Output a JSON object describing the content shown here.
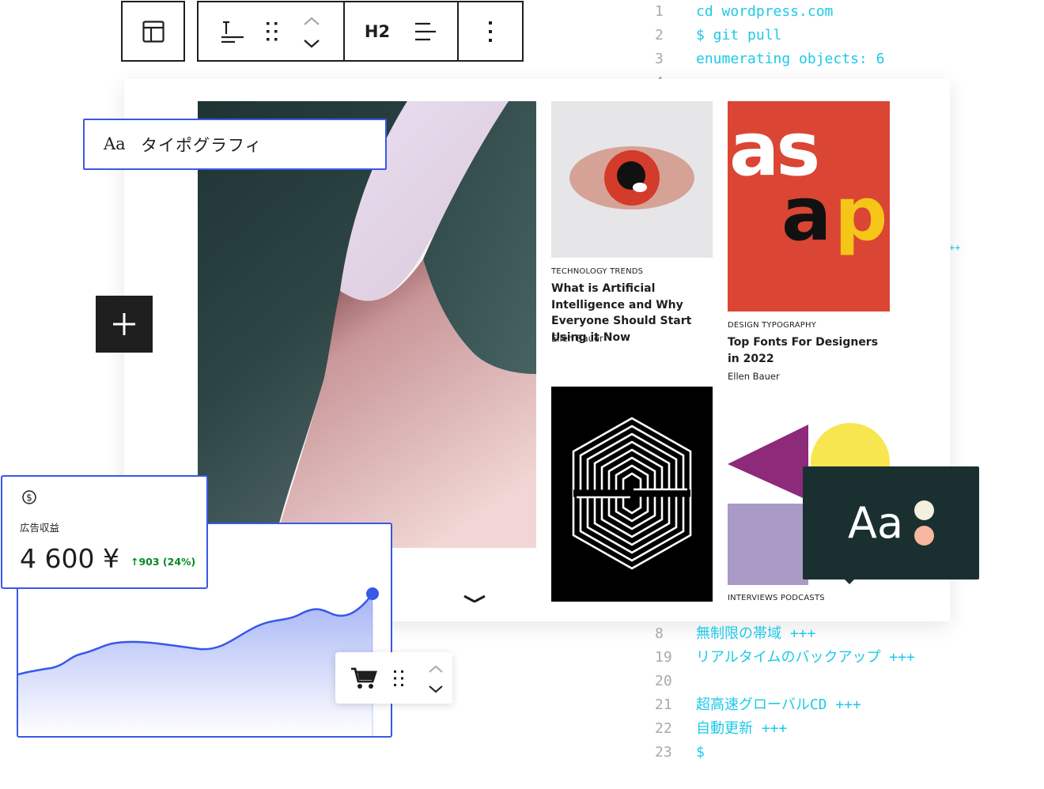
{
  "colors": {
    "accent": "#3858e9",
    "terminal_text": "#1ec9e8",
    "line_number": "#a7aaad",
    "dark": "#1e1e1e",
    "positive": "#008a20"
  },
  "toolbar": {
    "icons": [
      "layout-icon",
      "text-align-icon",
      "drag-handle-icon",
      "move-up-icon",
      "move-down-icon",
      "align-left-icon",
      "more-options-icon"
    ],
    "heading_level_label": "H2"
  },
  "terminal": {
    "top_lines": [
      {
        "num": "1",
        "text": "cd wordpress.com"
      },
      {
        "num": "2",
        "text": "$ git pull"
      },
      {
        "num": "3",
        "text": "enumerating objects: 6"
      },
      {
        "num": "4",
        "text": ""
      }
    ],
    "side_fragment": "++",
    "bottom_lines": [
      {
        "num": "8",
        "text": "無制限の帯域 +++"
      },
      {
        "num": "19",
        "text": "リアルタイムのバックアップ +++"
      },
      {
        "num": "20",
        "text": ""
      },
      {
        "num": "21",
        "text": "超高速グローバルCD +++"
      },
      {
        "num": "22",
        "text": "自動更新 +++"
      },
      {
        "num": "23",
        "text": "$"
      }
    ]
  },
  "typography_panel": {
    "aa": "Aa",
    "label": "タイポグラフィ"
  },
  "posts": [
    {
      "tags": "TECHNOLOGY  TRENDS",
      "title": "What is Artificial Intelligence and Why Everyone Should Start Using it Now",
      "author": "Ellen Bauer"
    },
    {
      "tags": "DESIGN  TYPOGRAPHY",
      "title": "Top Fonts For Designers in 2022",
      "author": "Ellen Bauer"
    },
    {
      "tags": "INTERVIEWS  PODCASTS"
    }
  ],
  "asap_poster": {
    "line1": "as",
    "line2_a": "a",
    "line2_p": "p"
  },
  "revenue": {
    "label": "広告収益",
    "amount": "4 600 ¥",
    "change": "↑903 (24%)",
    "icon": "dollar-circle-icon"
  },
  "product_toolbar": {
    "icons": [
      "cart-icon",
      "drag-handle-icon",
      "move-up-icon",
      "move-down-icon"
    ]
  },
  "font_preview": {
    "label": "Aa"
  }
}
